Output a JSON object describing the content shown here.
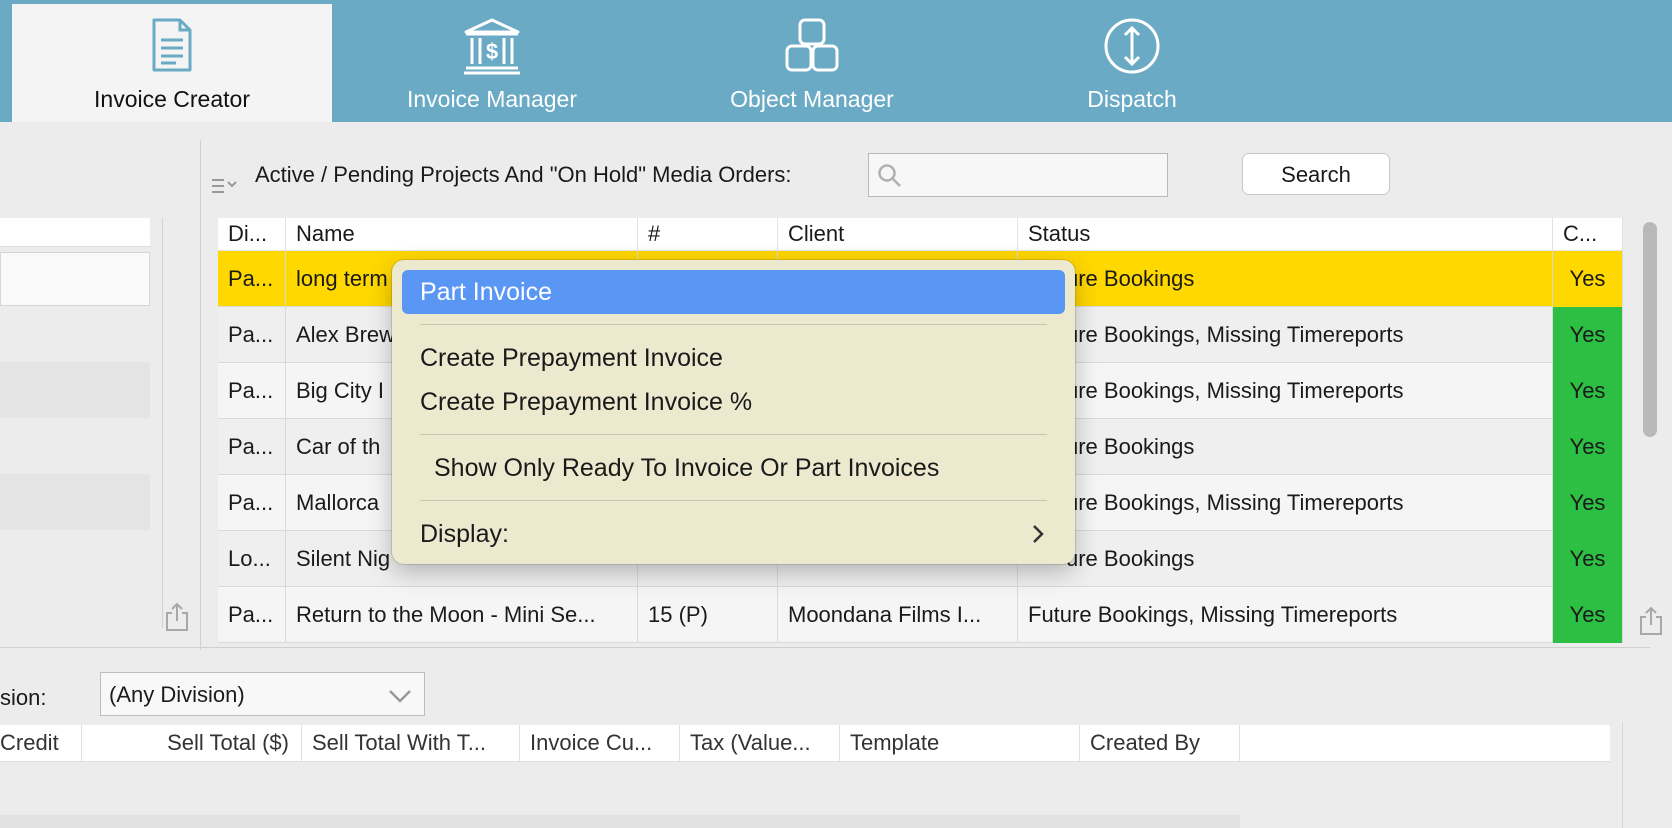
{
  "tabs": [
    {
      "label": "Invoice Creator",
      "icon": "document-icon",
      "active": true
    },
    {
      "label": "Invoice Manager",
      "icon": "bank-icon",
      "active": false
    },
    {
      "label": "Object Manager",
      "icon": "cubes-icon",
      "active": false
    },
    {
      "label": "Dispatch",
      "icon": "transfer-icon",
      "active": false
    }
  ],
  "projects": {
    "title": "Active / Pending Projects And \"On Hold\" Media Orders:",
    "search_value": "",
    "search_button": "Search",
    "columns": [
      "Di...",
      "Name",
      "#",
      "Client",
      "Status",
      "C..."
    ],
    "rows": [
      {
        "div": "Pa...",
        "name": "long term",
        "num": "",
        "client": "",
        "status": "ure Bookings",
        "c": "Yes",
        "selected": true
      },
      {
        "div": "Pa...",
        "name": "Alex Brew",
        "num": "",
        "client": "",
        "status": "ure Bookings, Missing Timereports",
        "c": "Yes"
      },
      {
        "div": "Pa...",
        "name": "Big City I",
        "num": "",
        "client": "",
        "status": "ure Bookings, Missing Timereports",
        "c": "Yes"
      },
      {
        "div": "Pa...",
        "name": "Car of th",
        "num": "",
        "client": "",
        "status": "ure Bookings",
        "c": "Yes"
      },
      {
        "div": "Pa...",
        "name": "Mallorca",
        "num": "",
        "client": "",
        "status": "ure Bookings, Missing Timereports",
        "c": "Yes"
      },
      {
        "div": "Lo...",
        "name": "Silent Nig",
        "num": "",
        "client": "",
        "status": "ure Bookings",
        "c": "Yes"
      },
      {
        "div": "Pa...",
        "name": "Return to the Moon - Mini Se...",
        "num": "15 (P)",
        "client": "Moondana Films I...",
        "status": "Future Bookings, Missing Timereports",
        "c": "Yes"
      }
    ]
  },
  "context_menu": {
    "items": [
      {
        "label": "Part Invoice",
        "highlighted": true
      },
      {
        "label": "Create Prepayment Invoice"
      },
      {
        "label": "Create Prepayment Invoice %"
      },
      {
        "label": "Show Only Ready To Invoice Or Part Invoices"
      },
      {
        "label": "Display:",
        "submenu": true
      }
    ]
  },
  "invoices": {
    "division_label": "sion:",
    "division_value": "(Any Division)",
    "columns": [
      "Credit",
      "Sell Total ($)",
      "Sell Total With T...",
      "Invoice Cu...",
      "Tax (Value...",
      "Template",
      "Created By"
    ]
  },
  "colors": {
    "topbar": "#6aaac5",
    "selected_row": "#ffd800",
    "ok_cell": "#2dbe44",
    "menu_highlight": "#5a97f5",
    "menu_bg": "#ece9cf"
  }
}
